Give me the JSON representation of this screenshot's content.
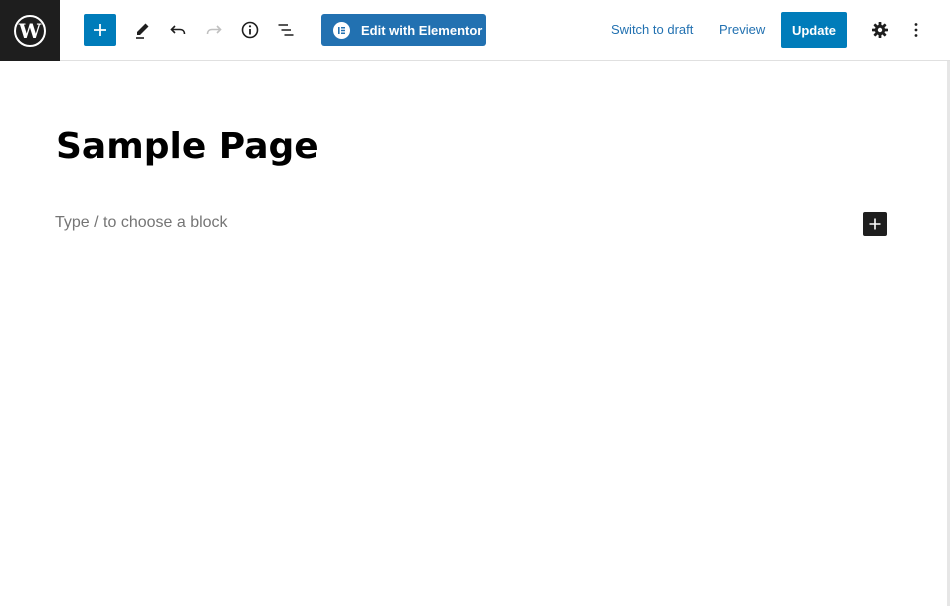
{
  "toolbar": {
    "logo": "wordpress-logo",
    "icons": {
      "inserter": "plus-icon",
      "tools": "pencil-icon",
      "undo": "undo-icon",
      "redo": "redo-icon",
      "details": "info-icon",
      "list_view": "list-view-icon",
      "settings": "gear-icon",
      "options": "more-vertical-icon"
    },
    "elementor_label": "Edit with Elementor",
    "switch_to_draft_label": "Switch to draft",
    "preview_label": "Preview",
    "update_label": "Update"
  },
  "editor": {
    "title": "Sample Page",
    "block_placeholder": "Type / to choose a block"
  },
  "colors": {
    "accent": "#007cba",
    "elementor": "#2271b1",
    "logo_bg": "#1e1e1e",
    "placeholder": "#757575"
  }
}
